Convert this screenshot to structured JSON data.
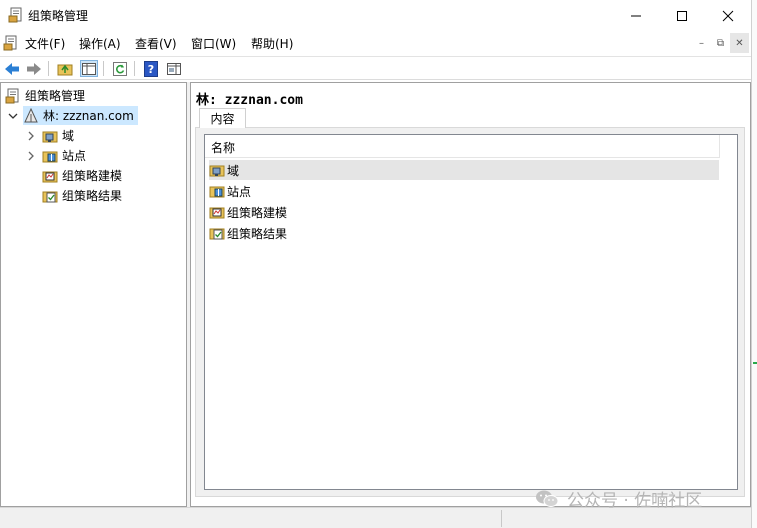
{
  "window": {
    "title": "组策略管理"
  },
  "menu": {
    "items": [
      "文件(F)",
      "操作(A)",
      "查看(V)",
      "窗口(W)",
      "帮助(H)"
    ]
  },
  "tree": {
    "root": "组策略管理",
    "forest": "林: zzznan.com",
    "children": [
      "域",
      "站点",
      "组策略建模",
      "组策略结果"
    ]
  },
  "content": {
    "header": "林: zzznan.com",
    "tab": "内容",
    "column": "名称",
    "rows": [
      "域",
      "站点",
      "组策略建模",
      "组策略结果"
    ]
  },
  "watermark": {
    "text": "公众号 · 佐喃社区"
  },
  "colors": {
    "selection": "#cce8ff",
    "row_hover": "#e5e5e5",
    "toolbar_arrow": "#2b7fd4",
    "help_icon": "#2a57c4"
  }
}
